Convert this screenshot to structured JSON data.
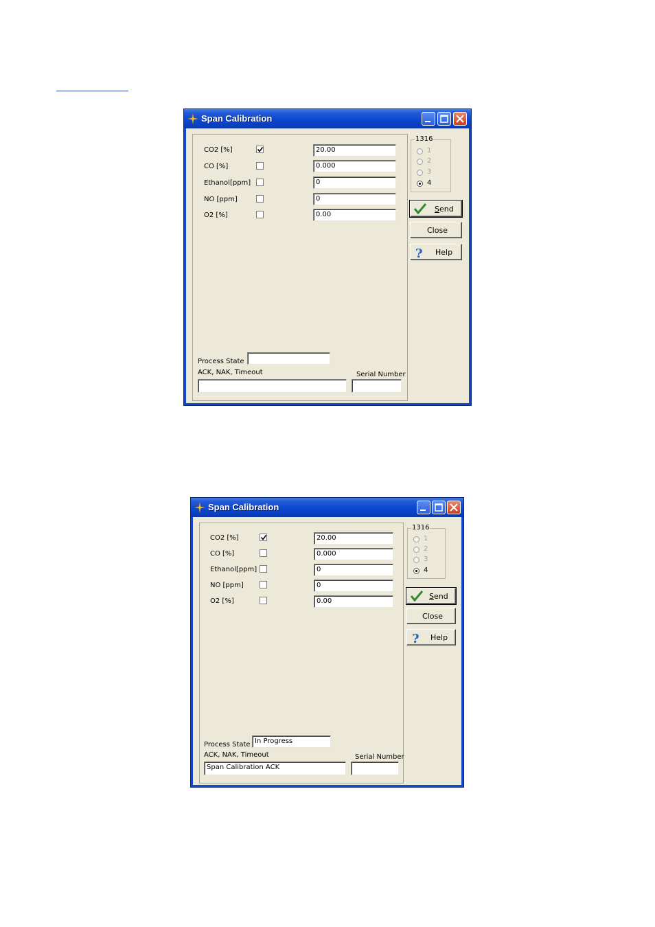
{
  "windows": [
    {
      "title": "Span Calibration",
      "fields": [
        {
          "label": "CO2 [%]",
          "checked": true,
          "value": "20.00"
        },
        {
          "label": "CO [%]",
          "checked": false,
          "value": "0.000"
        },
        {
          "label": "Ethanol[ppm]",
          "checked": false,
          "value": "0"
        },
        {
          "label": "NO [ppm]",
          "checked": false,
          "value": "0"
        },
        {
          "label": "O2 [%]",
          "checked": false,
          "value": "0.00"
        }
      ],
      "group_title": "1316",
      "radios": [
        {
          "label": "1",
          "selected": false,
          "enabled": false
        },
        {
          "label": "2",
          "selected": false,
          "enabled": false
        },
        {
          "label": "3",
          "selected": false,
          "enabled": false
        },
        {
          "label": "4",
          "selected": true,
          "enabled": true
        }
      ],
      "send_label_first": "S",
      "send_label_rest": "end",
      "close_label": "Close",
      "help_label": "Help",
      "process_state_label": "Process State",
      "process_state_value": "",
      "ack_label": "ACK, NAK, Timeout",
      "ack_value": "",
      "serial_label": "Serial Number",
      "serial_value": ""
    },
    {
      "title": "Span Calibration",
      "fields": [
        {
          "label": "CO2 [%]",
          "checked": true,
          "value": "20.00"
        },
        {
          "label": "CO [%]",
          "checked": false,
          "value": "0.000"
        },
        {
          "label": "Ethanol[ppm]",
          "checked": false,
          "value": "0"
        },
        {
          "label": "NO [ppm]",
          "checked": false,
          "value": "0"
        },
        {
          "label": "O2 [%]",
          "checked": false,
          "value": "0.00"
        }
      ],
      "group_title": "1316",
      "radios": [
        {
          "label": "1",
          "selected": false,
          "enabled": false
        },
        {
          "label": "2",
          "selected": false,
          "enabled": false
        },
        {
          "label": "3",
          "selected": false,
          "enabled": false
        },
        {
          "label": "4",
          "selected": true,
          "enabled": true
        }
      ],
      "send_label_first": "S",
      "send_label_rest": "end",
      "close_label": "Close",
      "help_label": "Help",
      "process_state_label": "Process State",
      "process_state_value": "In Progress",
      "ack_label": "ACK, NAK, Timeout",
      "ack_value": "Span Calibration  ACK",
      "serial_label": "Serial Number",
      "serial_value": ""
    }
  ],
  "colors": {
    "title_bar": "#0a48d0",
    "dialog_bg": "#ece9d8",
    "check_green": "#2e8b2e",
    "help_blue": "#1f5fbf"
  }
}
